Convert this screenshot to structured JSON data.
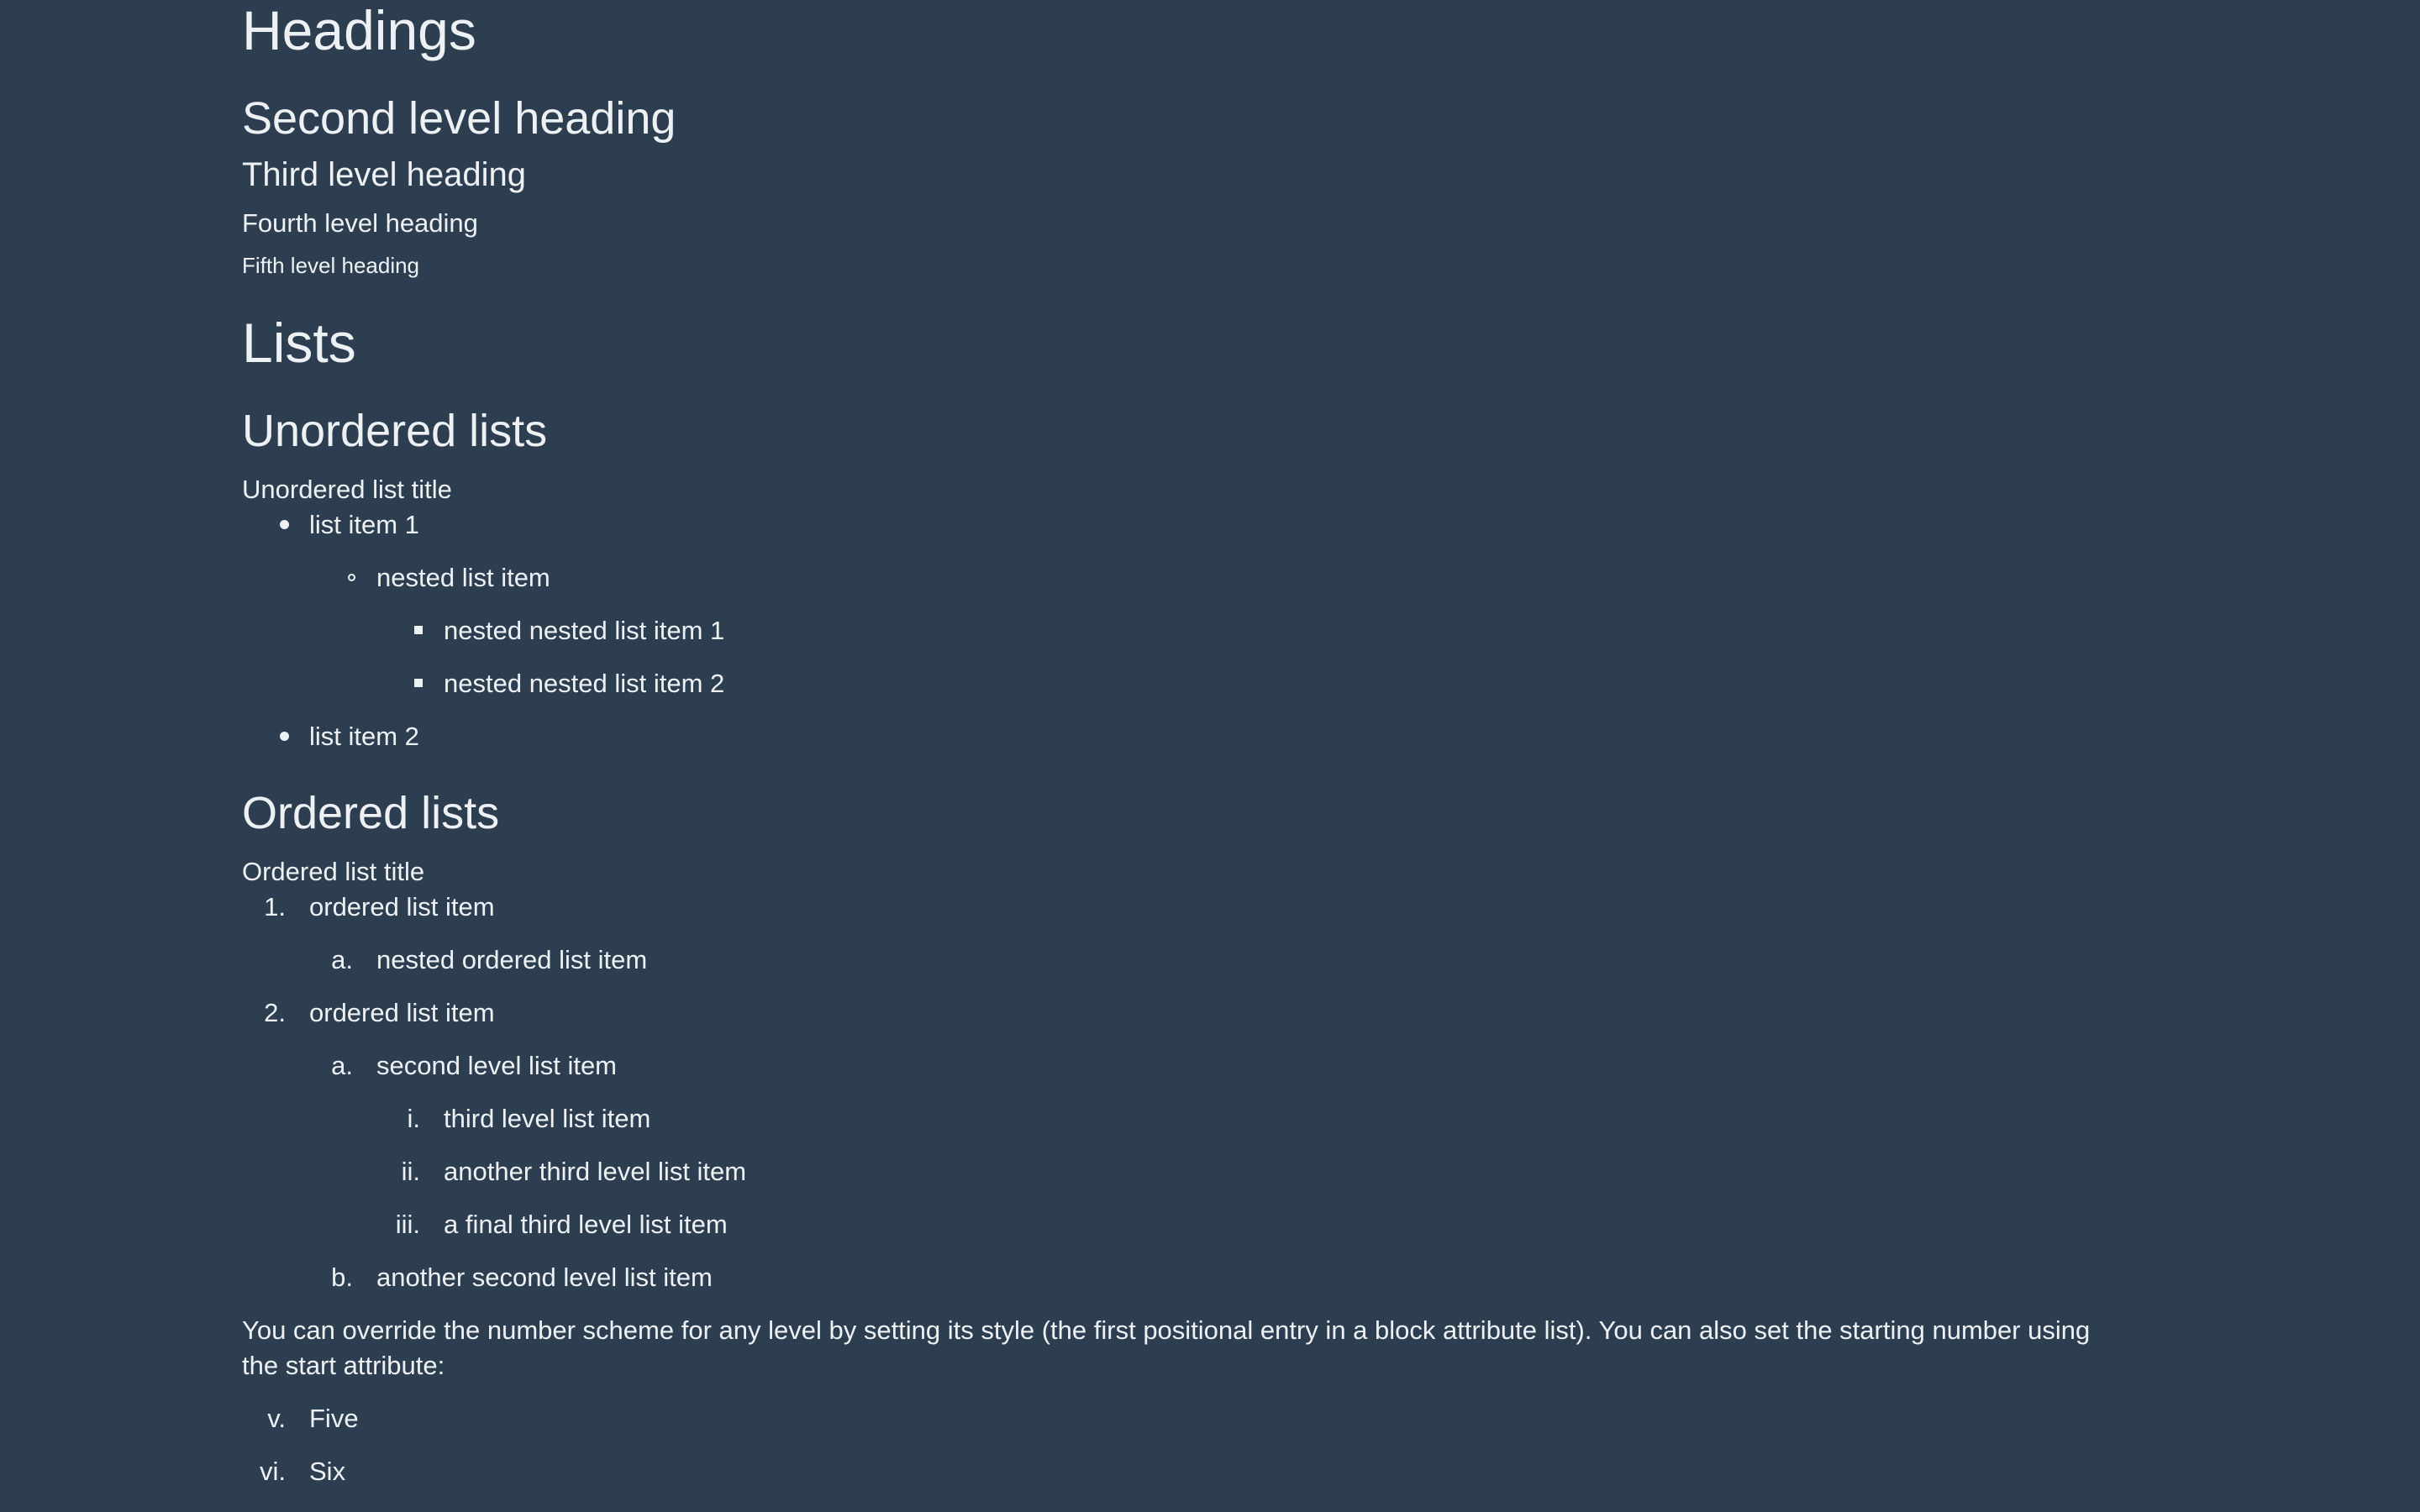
{
  "headings": {
    "h1": "Headings",
    "h2": "Second level heading",
    "h3": "Third level heading",
    "h4": "Fourth level heading",
    "h5": "Fifth level heading"
  },
  "lists": {
    "title": "Lists",
    "unordered": {
      "heading": "Unordered lists",
      "list_title": "Unordered list title",
      "item1": "list item 1",
      "nested": "nested list item",
      "nested_nested_1": "nested nested list item 1",
      "nested_nested_2": "nested nested list item 2",
      "item2": "list item 2"
    },
    "ordered": {
      "heading": "Ordered lists",
      "list_title": "Ordered list title",
      "items": [
        {
          "marker": "1.",
          "label": "ordered list item"
        },
        {
          "marker": "a.",
          "label": "nested ordered list item"
        },
        {
          "marker": "2.",
          "label": "ordered list item"
        },
        {
          "marker": "a.",
          "label": "second level list item"
        },
        {
          "marker": "i.",
          "label": "third level list item"
        },
        {
          "marker": "ii.",
          "label": "another third level list item"
        },
        {
          "marker": "iii.",
          "label": "a final third level list item"
        },
        {
          "marker": "b.",
          "label": "another second level list item"
        }
      ],
      "paragraph": "You can override the number scheme for any level by setting its style (the first positional entry in a block attribute list). You can also set the starting number using the start attribute:",
      "roman_items": [
        {
          "marker": "v.",
          "label": "Five"
        },
        {
          "marker": "vi.",
          "label": "Six"
        }
      ]
    }
  }
}
